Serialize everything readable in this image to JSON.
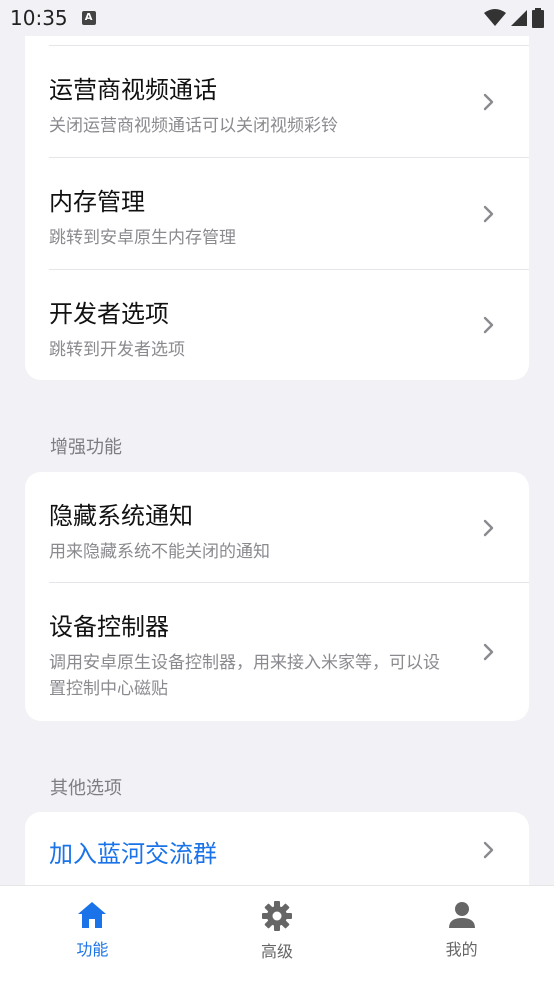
{
  "status_bar": {
    "time": "10:35",
    "badge": "A"
  },
  "card1": {
    "items": [
      {
        "title": "运营商视频通话",
        "subtitle": "关闭运营商视频通话可以关闭视频彩铃"
      },
      {
        "title": "内存管理",
        "subtitle": "跳转到安卓原生内存管理"
      },
      {
        "title": "开发者选项",
        "subtitle": "跳转到开发者选项"
      }
    ]
  },
  "section_enhanced": {
    "header": "增强功能",
    "items": [
      {
        "title": "隐藏系统通知",
        "subtitle": "用来隐藏系统不能关闭的通知"
      },
      {
        "title": "设备控制器",
        "subtitle": "调用安卓原生设备控制器，用来接入米家等，可以设置控制中心磁贴"
      }
    ]
  },
  "section_other": {
    "header": "其他选项",
    "items": [
      {
        "title": "加入蓝河交流群"
      }
    ]
  },
  "bottom_nav": {
    "items": [
      {
        "label": "功能",
        "icon": "home-icon",
        "active": true
      },
      {
        "label": "高级",
        "icon": "gear-icon",
        "active": false
      },
      {
        "label": "我的",
        "icon": "person-icon",
        "active": false
      }
    ]
  },
  "colors": {
    "accent": "#1a73e8",
    "background": "#f2f2f6"
  }
}
